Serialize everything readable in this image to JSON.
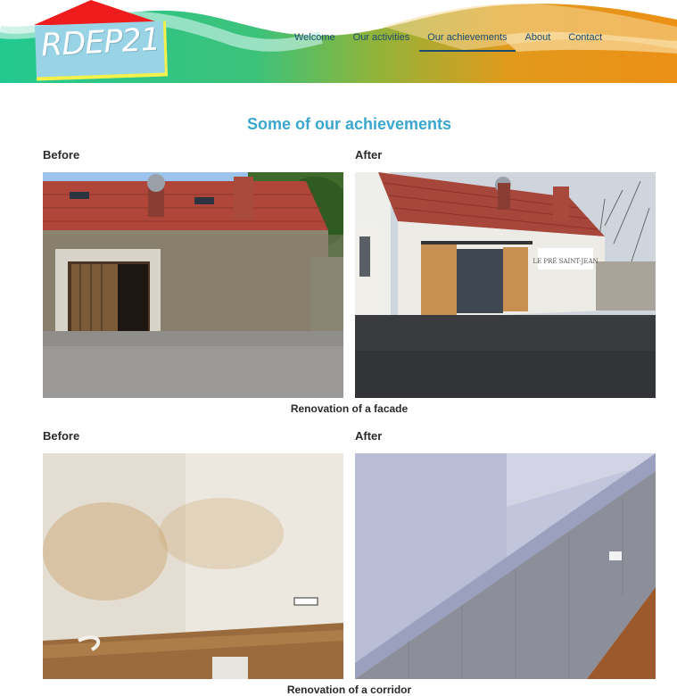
{
  "site": {
    "logo_text": "RDEP21"
  },
  "nav": {
    "items": [
      {
        "label": "Welcome"
      },
      {
        "label": "Our activities"
      },
      {
        "label": "Our achievements"
      },
      {
        "label": "About"
      },
      {
        "label": "Contact"
      }
    ],
    "active_index": 2
  },
  "page": {
    "title": "Some of our achievements"
  },
  "sections": [
    {
      "before_label": "Before",
      "after_label": "After",
      "caption": "Renovation of a facade",
      "sign_text": "LE PRÉ SAINT-JEAN"
    },
    {
      "before_label": "Before",
      "after_label": "After",
      "caption": "Renovation of a corridor"
    }
  ],
  "colors": {
    "title": "#3ba7ce",
    "nav_text": "#1b4c70",
    "header_green": "#2dc98c",
    "header_orange": "#ea9318",
    "logo_roof": "#ee1c1c",
    "logo_board": "#98d3e6",
    "logo_underline": "#f3f14a"
  }
}
